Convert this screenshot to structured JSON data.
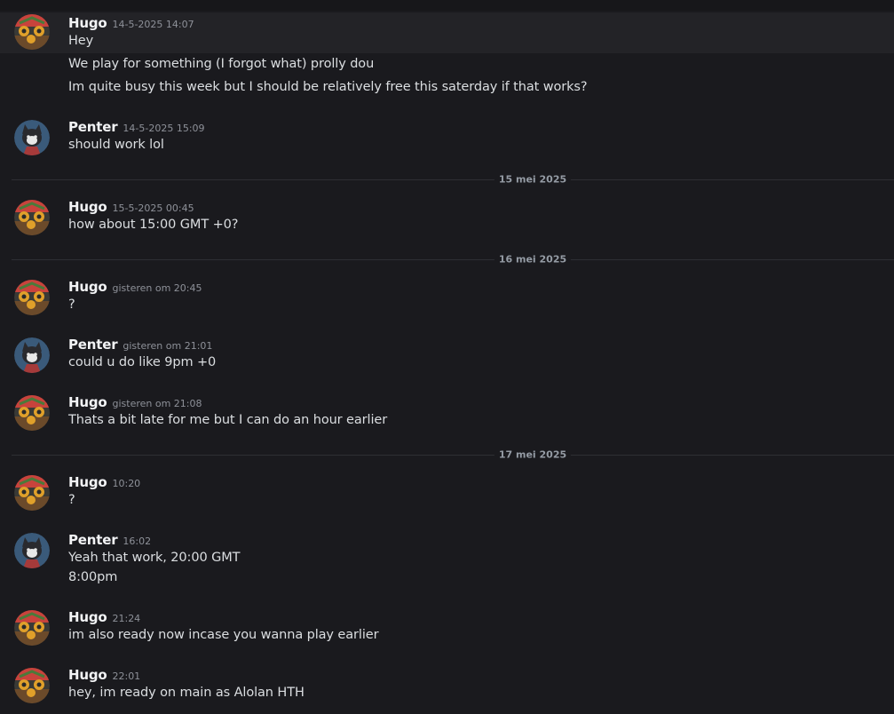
{
  "messages": [
    {
      "author": "Hugo",
      "timestamp": "14-5-2025 14:07",
      "lines": [
        "Hey",
        "We play for something (I forgot what) prolly dou",
        "Im quite busy this week but I should be relatively free this saterday if that works?"
      ]
    },
    {
      "author": "Penter",
      "timestamp": "14-5-2025 15:09",
      "lines": [
        "should work lol"
      ]
    },
    {
      "author": "Hugo",
      "timestamp": "15-5-2025 00:45",
      "lines": [
        "how about 15:00 GMT +0?"
      ]
    },
    {
      "author": "Hugo",
      "timestamp": "gisteren om 20:45",
      "lines": [
        "?"
      ]
    },
    {
      "author": "Penter",
      "timestamp": "gisteren om 21:01",
      "lines": [
        "could u do like 9pm +0"
      ]
    },
    {
      "author": "Hugo",
      "timestamp": "gisteren om 21:08",
      "lines": [
        "Thats a bit late for me but I can do an hour earlier"
      ]
    },
    {
      "author": "Hugo",
      "timestamp": "10:20",
      "lines": [
        "?"
      ]
    },
    {
      "author": "Penter",
      "timestamp": "16:02",
      "lines": [
        "Yeah that work, 20:00 GMT",
        "8:00pm"
      ]
    },
    {
      "author": "Hugo",
      "timestamp": "21:24",
      "lines": [
        "im also ready now incase you wanna play earlier"
      ]
    },
    {
      "author": "Hugo",
      "timestamp": "22:01",
      "lines": [
        "hey, im ready on main as Alolan HTH"
      ]
    }
  ],
  "date_dividers": [
    "15 mei 2025",
    "16 mei 2025",
    "17 mei 2025"
  ],
  "avatars": {
    "Hugo": {
      "icon": "hugo-avatar-icon",
      "colors": [
        "#c8433c",
        "#e0a02a",
        "#4a7a3a",
        "#6b4a2a"
      ]
    },
    "Penter": {
      "icon": "penter-avatar-icon",
      "colors": [
        "#3a5a7a",
        "#2a2a2e",
        "#a63a3a",
        "#e8e8e8"
      ]
    }
  },
  "theme": {
    "background": "#1a1a1e",
    "highlight": "#232327",
    "author_color": "#f2f3f5",
    "text_color": "#dbdee1",
    "timestamp_color": "#8e9199"
  }
}
